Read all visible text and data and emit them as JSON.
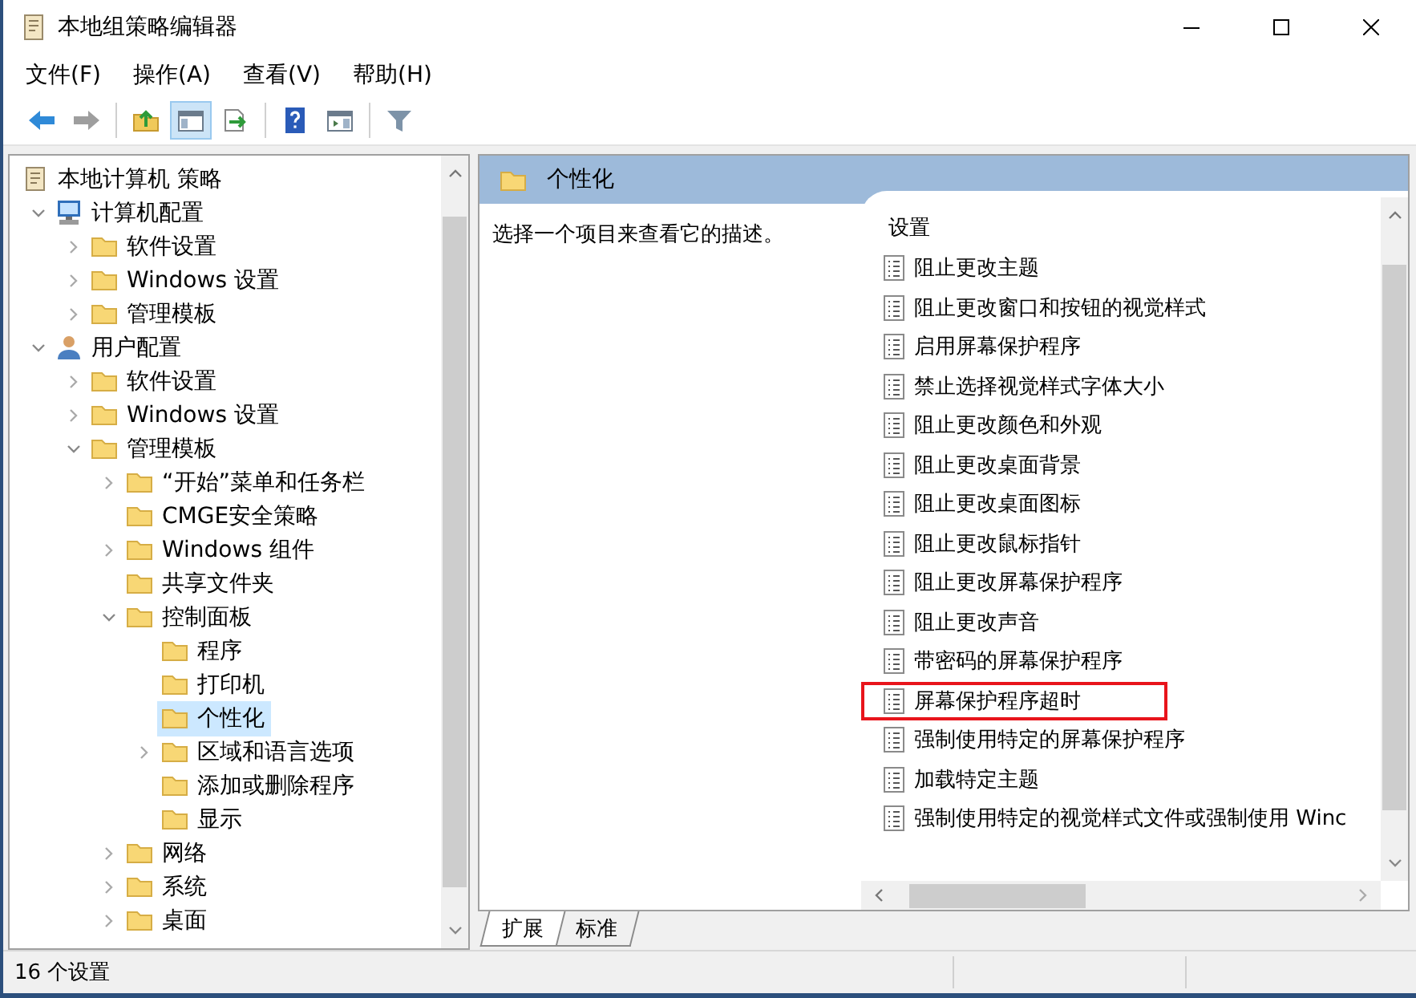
{
  "window": {
    "title": "本地组策略编辑器"
  },
  "menu": [
    "文件(F)",
    "操作(A)",
    "查看(V)",
    "帮助(H)"
  ],
  "toolbar_groups": [
    {
      "buttons": [
        {
          "kind": "back",
          "pressed": false,
          "disabled": false
        },
        {
          "kind": "forward",
          "pressed": false,
          "disabled": true
        }
      ]
    },
    {
      "buttons": [
        {
          "kind": "up",
          "pressed": false,
          "disabled": false
        },
        {
          "kind": "tree",
          "pressed": true,
          "disabled": false
        },
        {
          "kind": "export",
          "pressed": false,
          "disabled": false
        }
      ]
    },
    {
      "buttons": [
        {
          "kind": "help",
          "pressed": false,
          "disabled": false
        },
        {
          "kind": "pane",
          "pressed": false,
          "disabled": false
        }
      ]
    },
    {
      "buttons": [
        {
          "kind": "filter",
          "pressed": false,
          "disabled": false
        }
      ]
    }
  ],
  "tree": {
    "items": [
      {
        "label": "本地计算机 策略",
        "kind": "root",
        "selected": false,
        "children": [
          {
            "label": "计算机配置",
            "kind": "computer",
            "expanded": true,
            "selected": false,
            "children": [
              {
                "label": "软件设置",
                "kind": "folder",
                "expanded": false,
                "selected": false
              },
              {
                "label": "Windows 设置",
                "kind": "folder",
                "expanded": false,
                "selected": false
              },
              {
                "label": "管理模板",
                "kind": "folder",
                "expanded": false,
                "selected": false
              }
            ]
          },
          {
            "label": "用户配置",
            "kind": "user",
            "expanded": true,
            "selected": false,
            "children": [
              {
                "label": "软件设置",
                "kind": "folder",
                "expanded": false,
                "selected": false
              },
              {
                "label": "Windows 设置",
                "kind": "folder",
                "expanded": false,
                "selected": false
              },
              {
                "label": "管理模板",
                "kind": "folder",
                "expanded": true,
                "selected": false,
                "children": [
                  {
                    "label": "“开始”菜单和任务栏",
                    "kind": "folder",
                    "expanded": false,
                    "selected": false
                  },
                  {
                    "label": "CMGE安全策略",
                    "kind": "folder",
                    "selected": false
                  },
                  {
                    "label": "Windows 组件",
                    "kind": "folder",
                    "expanded": false,
                    "selected": false
                  },
                  {
                    "label": "共享文件夹",
                    "kind": "folder",
                    "selected": false
                  },
                  {
                    "label": "控制面板",
                    "kind": "folder",
                    "expanded": true,
                    "selected": false,
                    "children": [
                      {
                        "label": "程序",
                        "kind": "folder",
                        "selected": false
                      },
                      {
                        "label": "打印机",
                        "kind": "folder",
                        "selected": false
                      },
                      {
                        "label": "个性化",
                        "kind": "folder",
                        "selected": true
                      },
                      {
                        "label": "区域和语言选项",
                        "kind": "folder",
                        "expanded": false,
                        "selected": false
                      },
                      {
                        "label": "添加或删除程序",
                        "kind": "folder",
                        "selected": false
                      },
                      {
                        "label": "显示",
                        "kind": "folder",
                        "selected": false
                      }
                    ]
                  },
                  {
                    "label": "网络",
                    "kind": "folder",
                    "expanded": false,
                    "selected": false
                  },
                  {
                    "label": "系统",
                    "kind": "folder",
                    "expanded": false,
                    "selected": false
                  },
                  {
                    "label": "桌面",
                    "kind": "folder",
                    "expanded": false,
                    "selected": false
                  }
                ]
              }
            ]
          }
        ]
      }
    ]
  },
  "detail": {
    "header": "个性化",
    "description": "选择一个项目来查看它的描述。",
    "column": "设置",
    "items": [
      {
        "label": "阻止更改主题",
        "highlighted": false
      },
      {
        "label": "阻止更改窗口和按钮的视觉样式",
        "highlighted": false
      },
      {
        "label": "启用屏幕保护程序",
        "highlighted": false
      },
      {
        "label": "禁止选择视觉样式字体大小",
        "highlighted": false
      },
      {
        "label": "阻止更改颜色和外观",
        "highlighted": false
      },
      {
        "label": "阻止更改桌面背景",
        "highlighted": false
      },
      {
        "label": "阻止更改桌面图标",
        "highlighted": false
      },
      {
        "label": "阻止更改鼠标指针",
        "highlighted": false
      },
      {
        "label": "阻止更改屏幕保护程序",
        "highlighted": false
      },
      {
        "label": "阻止更改声音",
        "highlighted": false
      },
      {
        "label": "带密码的屏幕保护程序",
        "highlighted": false
      },
      {
        "label": "屏幕保护程序超时",
        "highlighted": true
      },
      {
        "label": "强制使用特定的屏幕保护程序",
        "highlighted": false
      },
      {
        "label": "加载特定主题",
        "highlighted": false
      },
      {
        "label": "强制使用特定的视觉样式文件或强制使用 Winc",
        "highlighted": false
      }
    ]
  },
  "view_tabs": [
    {
      "label": "扩展",
      "selected": true
    },
    {
      "label": "标准",
      "selected": false
    }
  ],
  "status_bar": {
    "text": "16 个设置"
  }
}
